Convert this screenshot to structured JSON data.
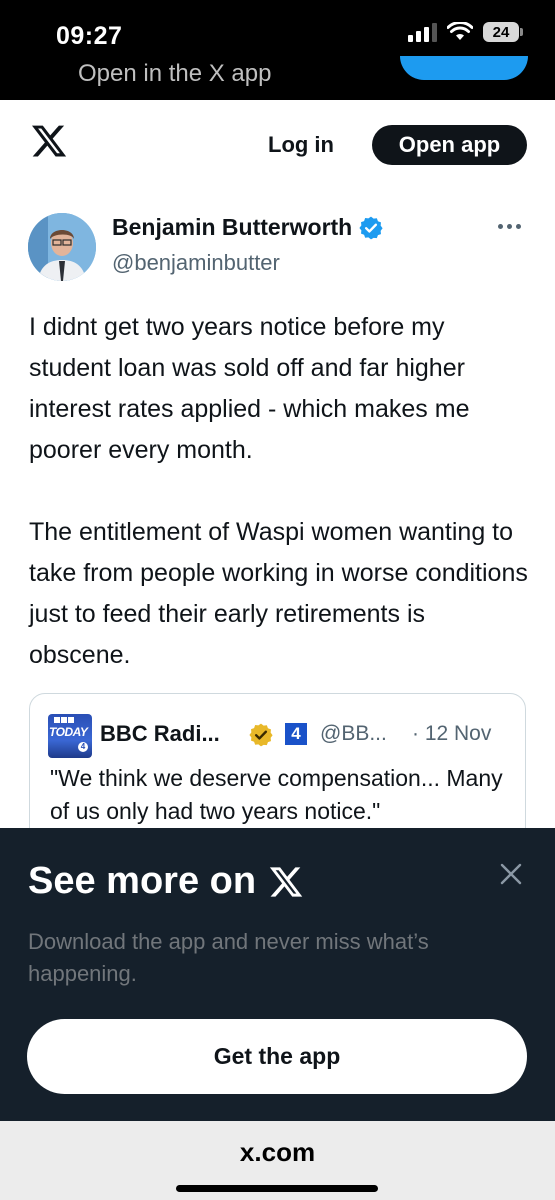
{
  "status_bar": {
    "time": "09:27",
    "battery": "24"
  },
  "open_in_app_banner": {
    "text": "Open in the X app"
  },
  "header": {
    "logo_icon": "x-logo-icon",
    "login_label": "Log in",
    "open_app_label": "Open app"
  },
  "tweet": {
    "author_name": "Benjamin Butterworth",
    "author_handle": "@benjaminbutter",
    "verified": true,
    "paragraphs": [
      "I didnt get two years notice before my student loan was sold off and far higher interest rates applied - which makes me poorer every month.",
      "The entitlement of Waspi women wanting to take from people working in worse conditions just to feed their early retirements is obscene."
    ]
  },
  "quote_tweet": {
    "author_name": "BBC Radi...",
    "radio_badge": "4",
    "author_handle": "@BB...",
    "date": "· 12 Nov",
    "text": "\"We think we deserve compensation... Many of us only had two years notice.\""
  },
  "bottom_sheet": {
    "title": "See more on",
    "description": "Download the app and never miss what’s happening.",
    "button_label": "Get the app"
  },
  "browser": {
    "url": "x.com"
  },
  "colors": {
    "accent_blue": "#1d9bf0",
    "sheet_background": "#15202b",
    "text_primary": "#0f1419",
    "text_secondary": "#536471"
  }
}
